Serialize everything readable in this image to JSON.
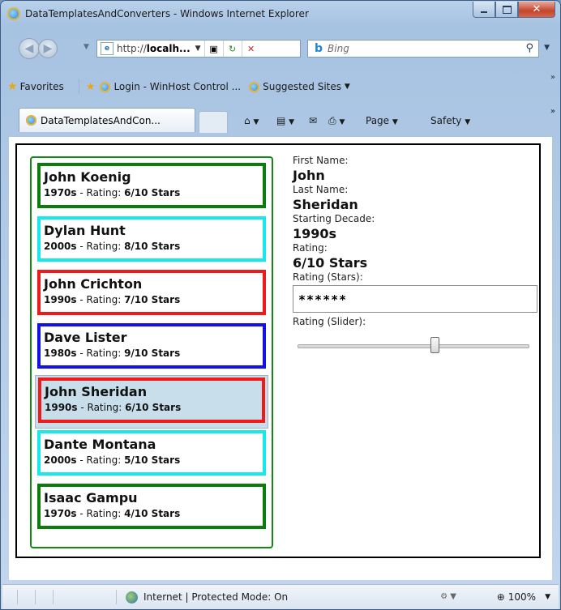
{
  "window": {
    "title": "DataTemplatesAndConverters - Windows Internet Explorer"
  },
  "address": {
    "url_prefix": "http://",
    "url_host": "localh...",
    "search_placeholder": "Bing"
  },
  "favorites": {
    "label": "Favorites",
    "item1": "Login - WinHost Control ...",
    "item2": "Suggested Sites"
  },
  "tabs": [
    {
      "label": "DataTemplatesAndCon..."
    }
  ],
  "commands": {
    "page": "Page",
    "safety": "Safety"
  },
  "people": [
    {
      "name": "John Koenig",
      "decade": "1970s",
      "rating_text": "6/10 Stars",
      "border": "#0a7d0a",
      "selected": false
    },
    {
      "name": "Dylan Hunt",
      "decade": "2000s",
      "rating_text": "8/10 Stars",
      "border": "#17e8ee",
      "selected": false
    },
    {
      "name": "John Crichton",
      "decade": "1990s",
      "rating_text": "7/10 Stars",
      "border": "#ee1b1b",
      "selected": false
    },
    {
      "name": "Dave Lister",
      "decade": "1980s",
      "rating_text": "9/10 Stars",
      "border": "#1212e6",
      "selected": false
    },
    {
      "name": "John Sheridan",
      "decade": "1990s",
      "rating_text": "6/10 Stars",
      "border": "#ee1b1b",
      "selected": true
    },
    {
      "name": "Dante Montana",
      "decade": "2000s",
      "rating_text": "5/10 Stars",
      "border": "#17e8ee",
      "selected": false
    },
    {
      "name": "Isaac Gampu",
      "decade": "1970s",
      "rating_text": "4/10 Stars",
      "border": "#0a7d0a",
      "selected": false
    }
  ],
  "item_meta_sep": " - Rating: ",
  "details": {
    "first_name_label": "First Name:",
    "first_name": "John",
    "last_name_label": "Last Name:",
    "last_name": "Sheridan",
    "decade_label": "Starting Decade:",
    "decade": "1990s",
    "rating_label": "Rating:",
    "rating": "6/10 Stars",
    "stars_label": "Rating (Stars):",
    "stars": "******",
    "slider_label": "Rating (Slider):",
    "slider_value": 6,
    "slider_max": 10
  },
  "status": {
    "zone": "Internet | Protected Mode: On",
    "zoom": "100%"
  },
  "colors": {
    "list_border": "#128a12",
    "selected_bg": "#c8dfeb"
  }
}
